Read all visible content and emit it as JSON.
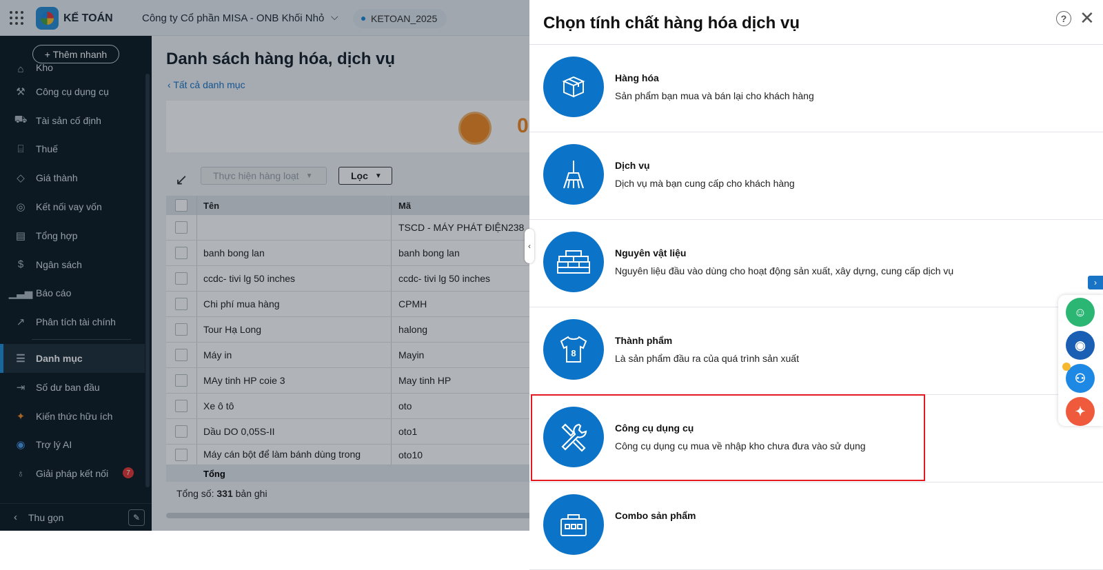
{
  "topbar": {
    "app_name": "KẾ TOÁN",
    "company": "Công ty Cổ phần MISA - ONB Khối Nhỏ",
    "database": "KETOAN_2025"
  },
  "sidebar": {
    "quick_add": "+ Thêm nhanh",
    "items": [
      {
        "label": "Kho",
        "icon": "warehouse-icon"
      },
      {
        "label": "Công cụ dụng cụ",
        "icon": "tools-icon"
      },
      {
        "label": "Tài sản cố định",
        "icon": "car-icon"
      },
      {
        "label": "Thuế",
        "icon": "bank-icon"
      },
      {
        "label": "Giá thành",
        "icon": "price-tag-icon"
      },
      {
        "label": "Kết nối vay vốn",
        "icon": "loan-icon"
      },
      {
        "label": "Tổng hợp",
        "icon": "ledger-icon"
      },
      {
        "label": "Ngân sách",
        "icon": "budget-icon"
      },
      {
        "label": "Báo cáo",
        "icon": "bar-chart-icon"
      },
      {
        "label": "Phân tích tài chính",
        "icon": "trend-icon"
      },
      {
        "label": "Danh mục",
        "icon": "list-icon"
      },
      {
        "label": "Số dư ban đầu",
        "icon": "balance-icon"
      },
      {
        "label": "Kiến thức hữu ích",
        "icon": "knowledge-icon"
      },
      {
        "label": "Trợ lý AI",
        "icon": "robot-icon"
      },
      {
        "label": "Giải pháp kết nối",
        "icon": "bulb-icon"
      }
    ],
    "badge_count": "7",
    "collapse_label": "Thu gọn"
  },
  "main": {
    "page_title": "Danh sách hàng hóa, dịch vụ",
    "back_link": "Tất cả danh mục",
    "banner_number": "0",
    "bulk_action": "Thực hiện hàng loạt",
    "filter": "Lọc",
    "table": {
      "headers": [
        "Tên",
        "Mã"
      ],
      "rows": [
        {
          "name": "",
          "code": "TSCD - MÁY PHÁT ĐIỆN238"
        },
        {
          "name": "banh bong lan",
          "code": "banh bong lan"
        },
        {
          "name": "ccdc- tivi lg 50 inches",
          "code": "ccdc- tivi lg 50 inches"
        },
        {
          "name": "Chi phí mua hàng",
          "code": "CPMH"
        },
        {
          "name": "Tour Hạ Long",
          "code": "halong"
        },
        {
          "name": "Máy in",
          "code": "Mayin"
        },
        {
          "name": "MAy tinh HP coie 3",
          "code": "May tinh HP"
        },
        {
          "name": "Xe ô tô",
          "code": "oto"
        },
        {
          "name": "Dầu DO 0,05S-II",
          "code": "oto1"
        },
        {
          "name": "Máy cán bột để làm bánh dùng trong",
          "code": "oto10"
        }
      ],
      "footer_label": "Tổng"
    },
    "total_prefix": "Tổng số: ",
    "total_count": "331",
    "total_suffix": " bản ghi"
  },
  "panel": {
    "title": "Chọn tính chất hàng hóa dịch vụ",
    "options": [
      {
        "title": "Hàng hóa",
        "desc": "Sản phẩm bạn mua và bán lại cho khách hàng",
        "icon": "box-icon"
      },
      {
        "title": "Dịch vụ",
        "desc": "Dịch vụ mà bạn cung cấp cho khách hàng",
        "icon": "broom-icon"
      },
      {
        "title": "Nguyên vật liệu",
        "desc": "Nguyên liệu đầu vào dùng cho hoạt động sản xuất, xây dựng, cung cấp dịch vụ",
        "icon": "bricks-icon"
      },
      {
        "title": "Thành phẩm",
        "desc": "Là sản phẩm đầu ra của quá trình sản xuất",
        "icon": "shirt-icon"
      },
      {
        "title": "Công cụ dụng cụ",
        "desc": "Công cụ dụng cụ mua về nhập kho chưa đưa vào sử dụng",
        "icon": "wrench-icon"
      },
      {
        "title": "Combo sản phẩm",
        "desc": "",
        "icon": "combo-box-icon"
      }
    ],
    "selected_index": 4
  },
  "colors": {
    "accent": "#0b74c8",
    "sidebar_bg": "#0e1b24",
    "highlight": "#e3191f",
    "banner_orange": "#f08a24"
  }
}
